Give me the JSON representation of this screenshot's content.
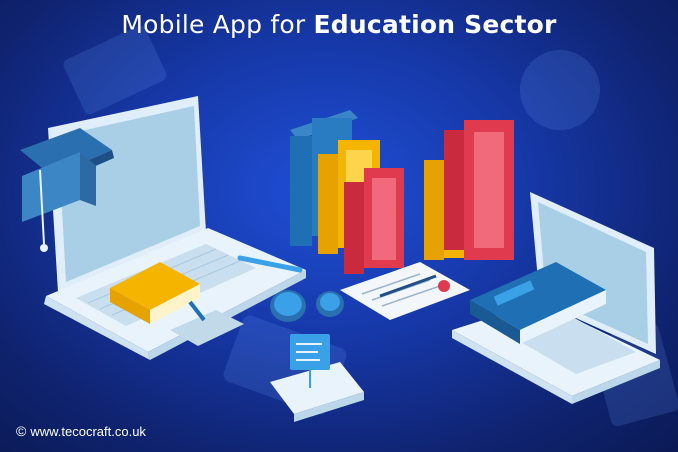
{
  "headline": {
    "prefix": "Mobile App for",
    "emphasis": "Education Sector"
  },
  "footer": {
    "copyright_symbol": "©",
    "website": "www.tecocraft.co.uk"
  },
  "illustration": {
    "items": [
      "laptop-left",
      "graduation-cap",
      "book-stack",
      "diploma-certificate",
      "chat-bubbles",
      "smartphone",
      "laptop-right"
    ],
    "colors": {
      "background_dark": "#0b1a55",
      "background_light": "#1f4fd6",
      "device_body": "#e8f3fb",
      "device_screen": "#a9cfe6",
      "book_blue": "#1f6fb5",
      "book_yellow": "#f4b400",
      "book_red": "#e03a4e",
      "accent_blue": "#3aa0e8"
    }
  }
}
